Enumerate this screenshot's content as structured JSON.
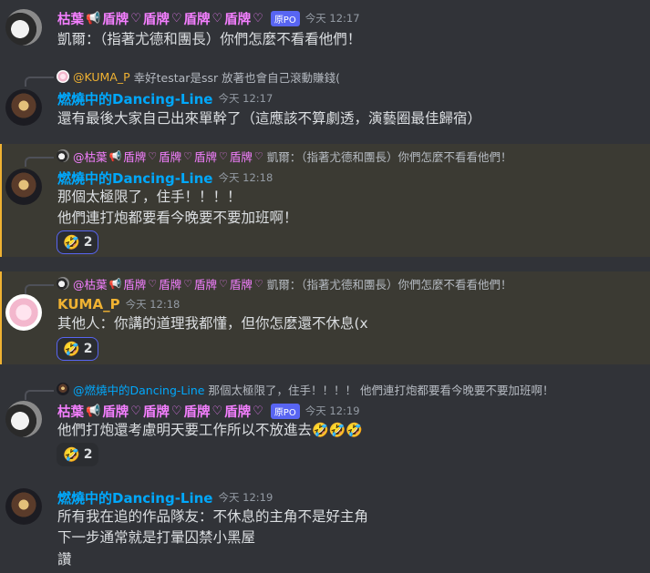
{
  "messages": [
    {
      "author_parts": [
        "枯葉",
        "盾牌",
        "盾牌",
        "盾牌",
        "盾牌"
      ],
      "op_badge": "原PO",
      "time": "今天 12:17",
      "lines": [
        "凱爾：（指著尤德和團長）你們怎麼不看看他們！"
      ]
    },
    {
      "reply_author": "@KUMA_P",
      "reply_text": "幸好testar是ssr 放著也會自己滾動賺錢(",
      "author": "燃燒中的Dancing-Line",
      "time": "今天 12:17",
      "lines": [
        "還有最後大家自己出來單幹了（這應該不算劇透，演藝圈最佳歸宿）"
      ]
    },
    {
      "reply_author_parts": [
        "@枯葉",
        "盾牌",
        "盾牌",
        "盾牌",
        "盾牌"
      ],
      "reply_text": "凱爾：（指著尤德和團長）你們怎麼不看看他們！",
      "author": "燃燒中的Dancing-Line",
      "time": "今天 12:18",
      "lines": [
        "那個太極限了，住手！！！！",
        "他們連打炮都要看今晚要不要加班啊！"
      ],
      "reaction_count": "2"
    },
    {
      "reply_author_parts": [
        "@枯葉",
        "盾牌",
        "盾牌",
        "盾牌",
        "盾牌"
      ],
      "reply_text": "凱爾：（指著尤德和團長）你們怎麼不看看他們！",
      "author": "KUMA_P",
      "time": "今天 12:18",
      "lines": [
        "其他人：你講的道理我都懂，但你怎麼還不休息(x"
      ],
      "reaction_count": "2"
    },
    {
      "reply_author": "@燃燒中的Dancing-Line",
      "reply_text": "那個太極限了，住手！！！！ 他們連打炮都要看今晚要不要加班啊！",
      "author_parts": [
        "枯葉",
        "盾牌",
        "盾牌",
        "盾牌",
        "盾牌"
      ],
      "op_badge": "原PO",
      "time": "今天 12:19",
      "lines": [
        "他們打炮還考慮明天要工作所以不放進去"
      ],
      "reaction_count": "2"
    },
    {
      "author": "燃燒中的Dancing-Line",
      "time": "今天 12:19",
      "lines": [
        "所有我在追的作品隊友：不休息的主角不是好主角",
        "下一步通常就是打暈囚禁小黑屋",
        "讚"
      ]
    }
  ],
  "icons": {
    "horn": "megaphone-icon",
    "heart": "heart-icon",
    "reaction": "rolling-on-floor-laughing-emoji"
  },
  "colors": {
    "background": "#313338",
    "highlight": "#3b3a33",
    "pink_name": "#f47fff",
    "blue_name": "#00a8fc",
    "orange_name": "#f0b232",
    "badge": "#5865f2"
  }
}
